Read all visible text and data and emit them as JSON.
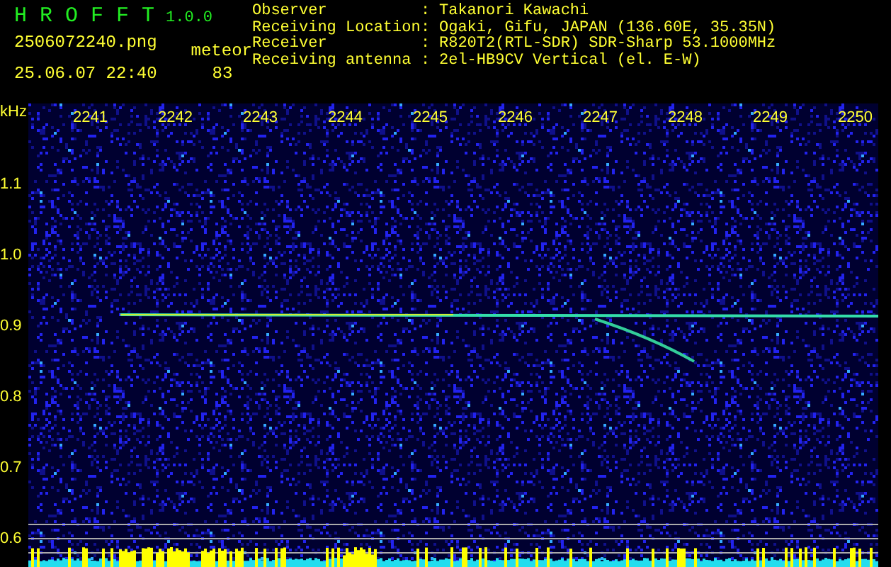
{
  "app": {
    "title": "H R O F F T",
    "version": "1.0.0"
  },
  "file_name": "2506072240.png",
  "timestamp": "25.06.07 22:40",
  "meteor": {
    "label": "meteor",
    "count": "83"
  },
  "info": [
    {
      "label": "Observer",
      "separator": ":",
      "value": "Takanori Kawachi"
    },
    {
      "label": "Receiving Location",
      "separator": ":",
      "value": "Ogaki, Gifu, JAPAN (136.60E, 35.35N)"
    },
    {
      "label": "Receiver",
      "separator": ":",
      "value": "R820T2(RTL-SDR) SDR-Sharp 53.1000MHz"
    },
    {
      "label": "Receiving antenna",
      "separator": ":",
      "value": "2el-HB9CV Vertical (el. E-W)"
    }
  ],
  "plot": {
    "unit_label": "kHz",
    "x_ticks": [
      "2241",
      "2242",
      "2243",
      "2244",
      "2245",
      "2246",
      "2247",
      "2248",
      "2249",
      "2250"
    ],
    "y_ticks": [
      "1.1",
      "1.0",
      "0.9",
      "0.8",
      "0.7",
      "0.6"
    ]
  }
}
